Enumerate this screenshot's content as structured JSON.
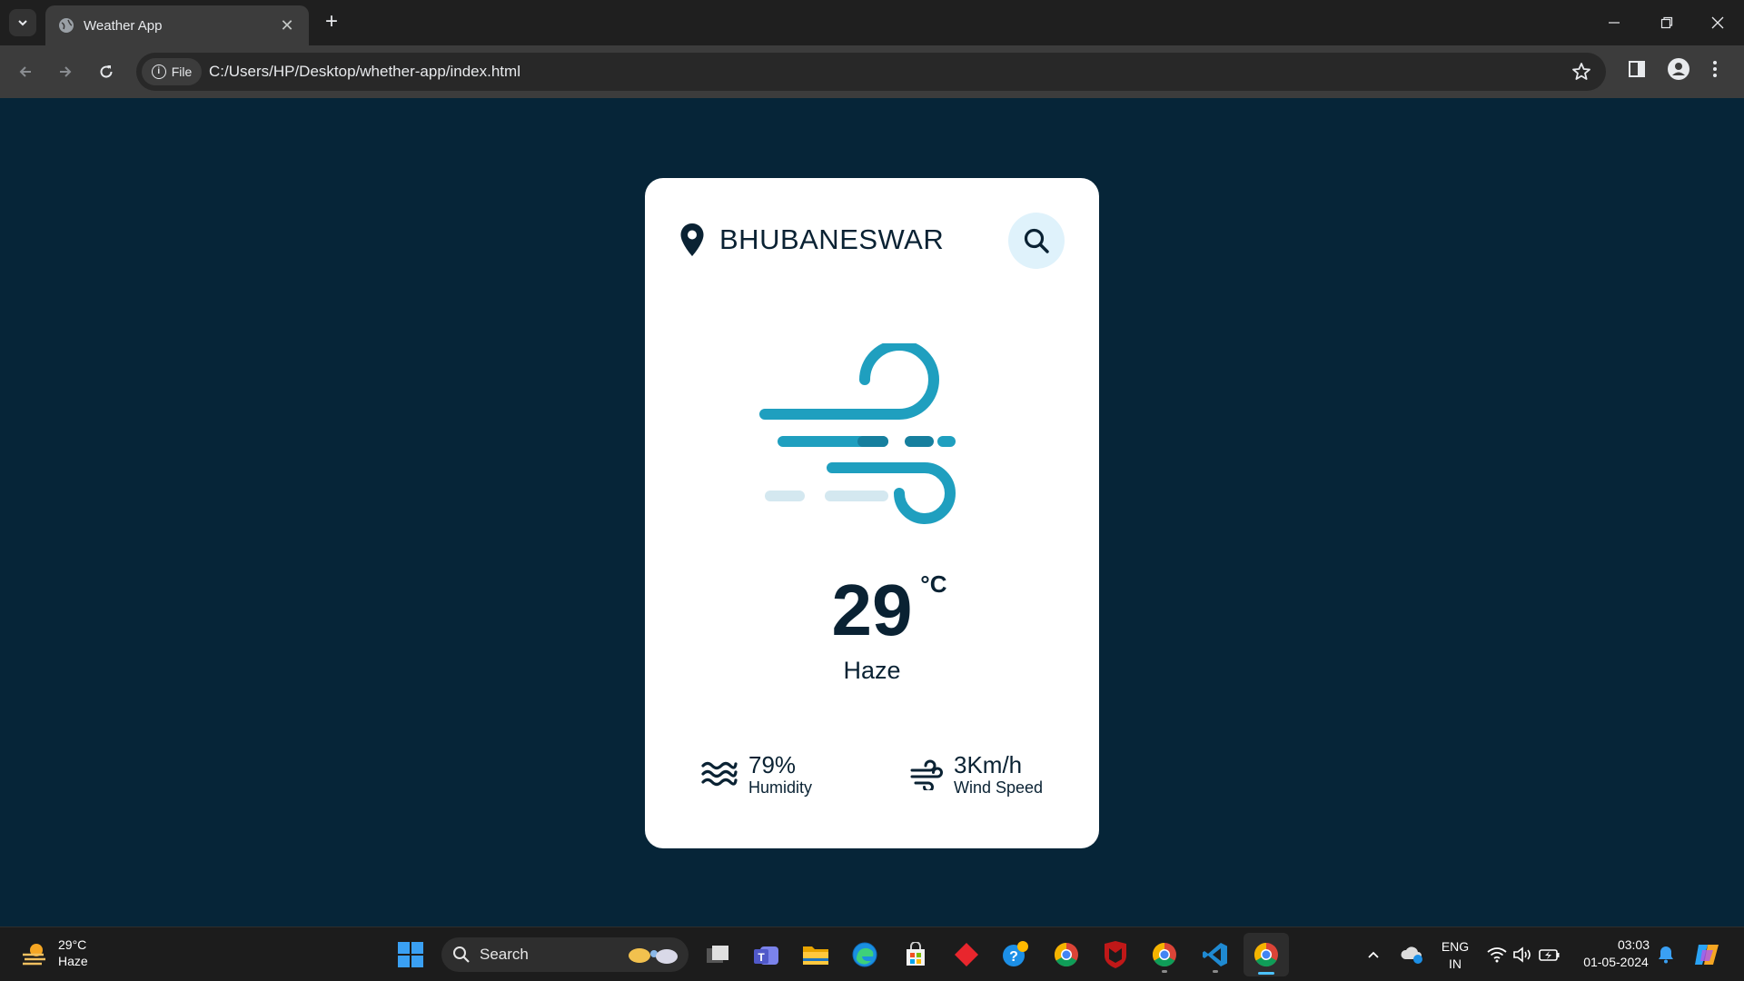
{
  "browser": {
    "tab_title": "Weather App",
    "chip_label": "File",
    "url": "C:/Users/HP/Desktop/whether-app/index.html"
  },
  "app": {
    "city": "BHUBANESWAR",
    "temperature": "29",
    "unit": "°C",
    "condition": "Haze",
    "humidity_value": "79%",
    "humidity_label": "Humidity",
    "wind_value": "3Km/h",
    "wind_label": "Wind Speed",
    "colors": {
      "page_bg": "#062538",
      "card_bg": "#ffffff",
      "text": "#0a2233",
      "accent": "#1f9fbf",
      "search_bg": "#dff2fb"
    }
  },
  "taskbar": {
    "weather_temp": "29°C",
    "weather_desc": "Haze",
    "search_label": "Search",
    "language": "ENG",
    "region": "IN",
    "time": "03:03",
    "date": "01-05-2024"
  }
}
